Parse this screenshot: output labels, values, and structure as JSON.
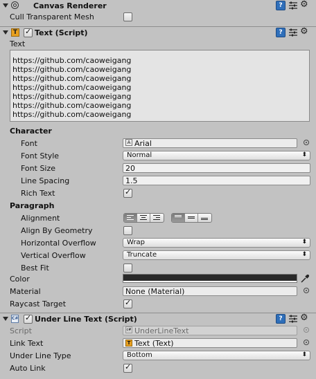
{
  "canvas_renderer": {
    "title": "Canvas Renderer",
    "cull_label": "Cull Transparent Mesh",
    "cull_checked": false
  },
  "text_script": {
    "title": "Text (Script)",
    "enabled": true,
    "text_label": "Text",
    "text_lines": [
      "https://github.com/caoweigang",
      "https://github.com/caoweigang",
      "https://github.com/caoweigang",
      "https://github.com/caoweigang",
      "https://github.com/caoweigang",
      "https://github.com/caoweigang",
      "https://github.com/caoweigang"
    ],
    "character_label": "Character",
    "font_label": "Font",
    "font_value": "Arial",
    "font_style_label": "Font Style",
    "font_style_value": "Normal",
    "font_size_label": "Font Size",
    "font_size_value": "20",
    "line_spacing_label": "Line Spacing",
    "line_spacing_value": "1.5",
    "rich_text_label": "Rich Text",
    "rich_text_checked": true,
    "paragraph_label": "Paragraph",
    "alignment_label": "Alignment",
    "align_by_geometry_label": "Align By Geometry",
    "horizontal_overflow_label": "Horizontal Overflow",
    "horizontal_overflow_value": "Wrap",
    "vertical_overflow_label": "Vertical Overflow",
    "vertical_overflow_value": "Truncate",
    "best_fit_label": "Best Fit",
    "color_label": "Color",
    "color_value": "#282828",
    "material_label": "Material",
    "material_value": "None (Material)",
    "raycast_label": "Raycast Target",
    "raycast_checked": true
  },
  "underline_script": {
    "title": "Under Line Text (Script)",
    "enabled": true,
    "script_label": "Script",
    "script_value": "UnderLineText",
    "link_text_label": "Link Text",
    "link_text_value": "Text (Text)",
    "underline_type_label": "Under Line Type",
    "underline_type_value": "Bottom",
    "auto_link_label": "Auto Link",
    "auto_link_checked": true
  },
  "icons": {
    "help": "help-icon",
    "settings": "sliders-icon",
    "gear": "gear-icon"
  }
}
